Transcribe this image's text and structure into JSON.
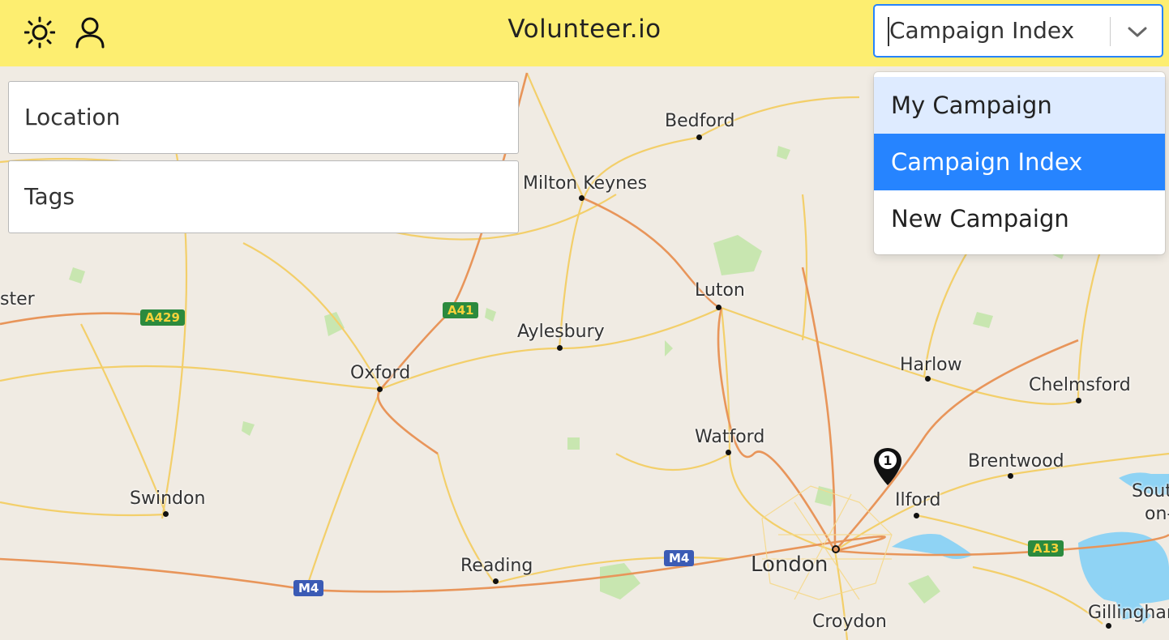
{
  "header": {
    "app_title": "Volunteer.io",
    "theme_icon": "sun-icon",
    "profile_icon": "user-icon",
    "campaign_select": {
      "value": "Campaign Index",
      "options": [
        "My Campaign",
        "Campaign Index",
        "New Campaign"
      ],
      "focused_option": "My Campaign",
      "selected_option": "Campaign Index"
    }
  },
  "filters": {
    "location_placeholder": "Location",
    "tags_placeholder": "Tags"
  },
  "map": {
    "places": [
      {
        "name": "Bedford"
      },
      {
        "name": "Milton Keynes"
      },
      {
        "name": "Luton"
      },
      {
        "name": "Aylesbury"
      },
      {
        "name": "Oxford"
      },
      {
        "name": "Harlow"
      },
      {
        "name": "Chelmsford"
      },
      {
        "name": "Watford"
      },
      {
        "name": "Brentwood"
      },
      {
        "name": "Swindon"
      },
      {
        "name": "Ilford"
      },
      {
        "name": "Reading"
      },
      {
        "name": "London"
      },
      {
        "name": "Croydon"
      },
      {
        "name": "Gillingham"
      },
      {
        "name": "ster"
      },
      {
        "name": "Sout"
      },
      {
        "name": "on-"
      }
    ],
    "road_shields": [
      "A429",
      "A41",
      "M4",
      "M4",
      "A13"
    ],
    "marker_count": "1",
    "colors": {
      "land": "#f0ebe3",
      "park": "#c8e6b0",
      "water": "#8fd3f4",
      "major_road": "#e8955a",
      "minor_road": "#f3cf6a",
      "header": "#fdee70",
      "accent": "#2684ff"
    }
  }
}
